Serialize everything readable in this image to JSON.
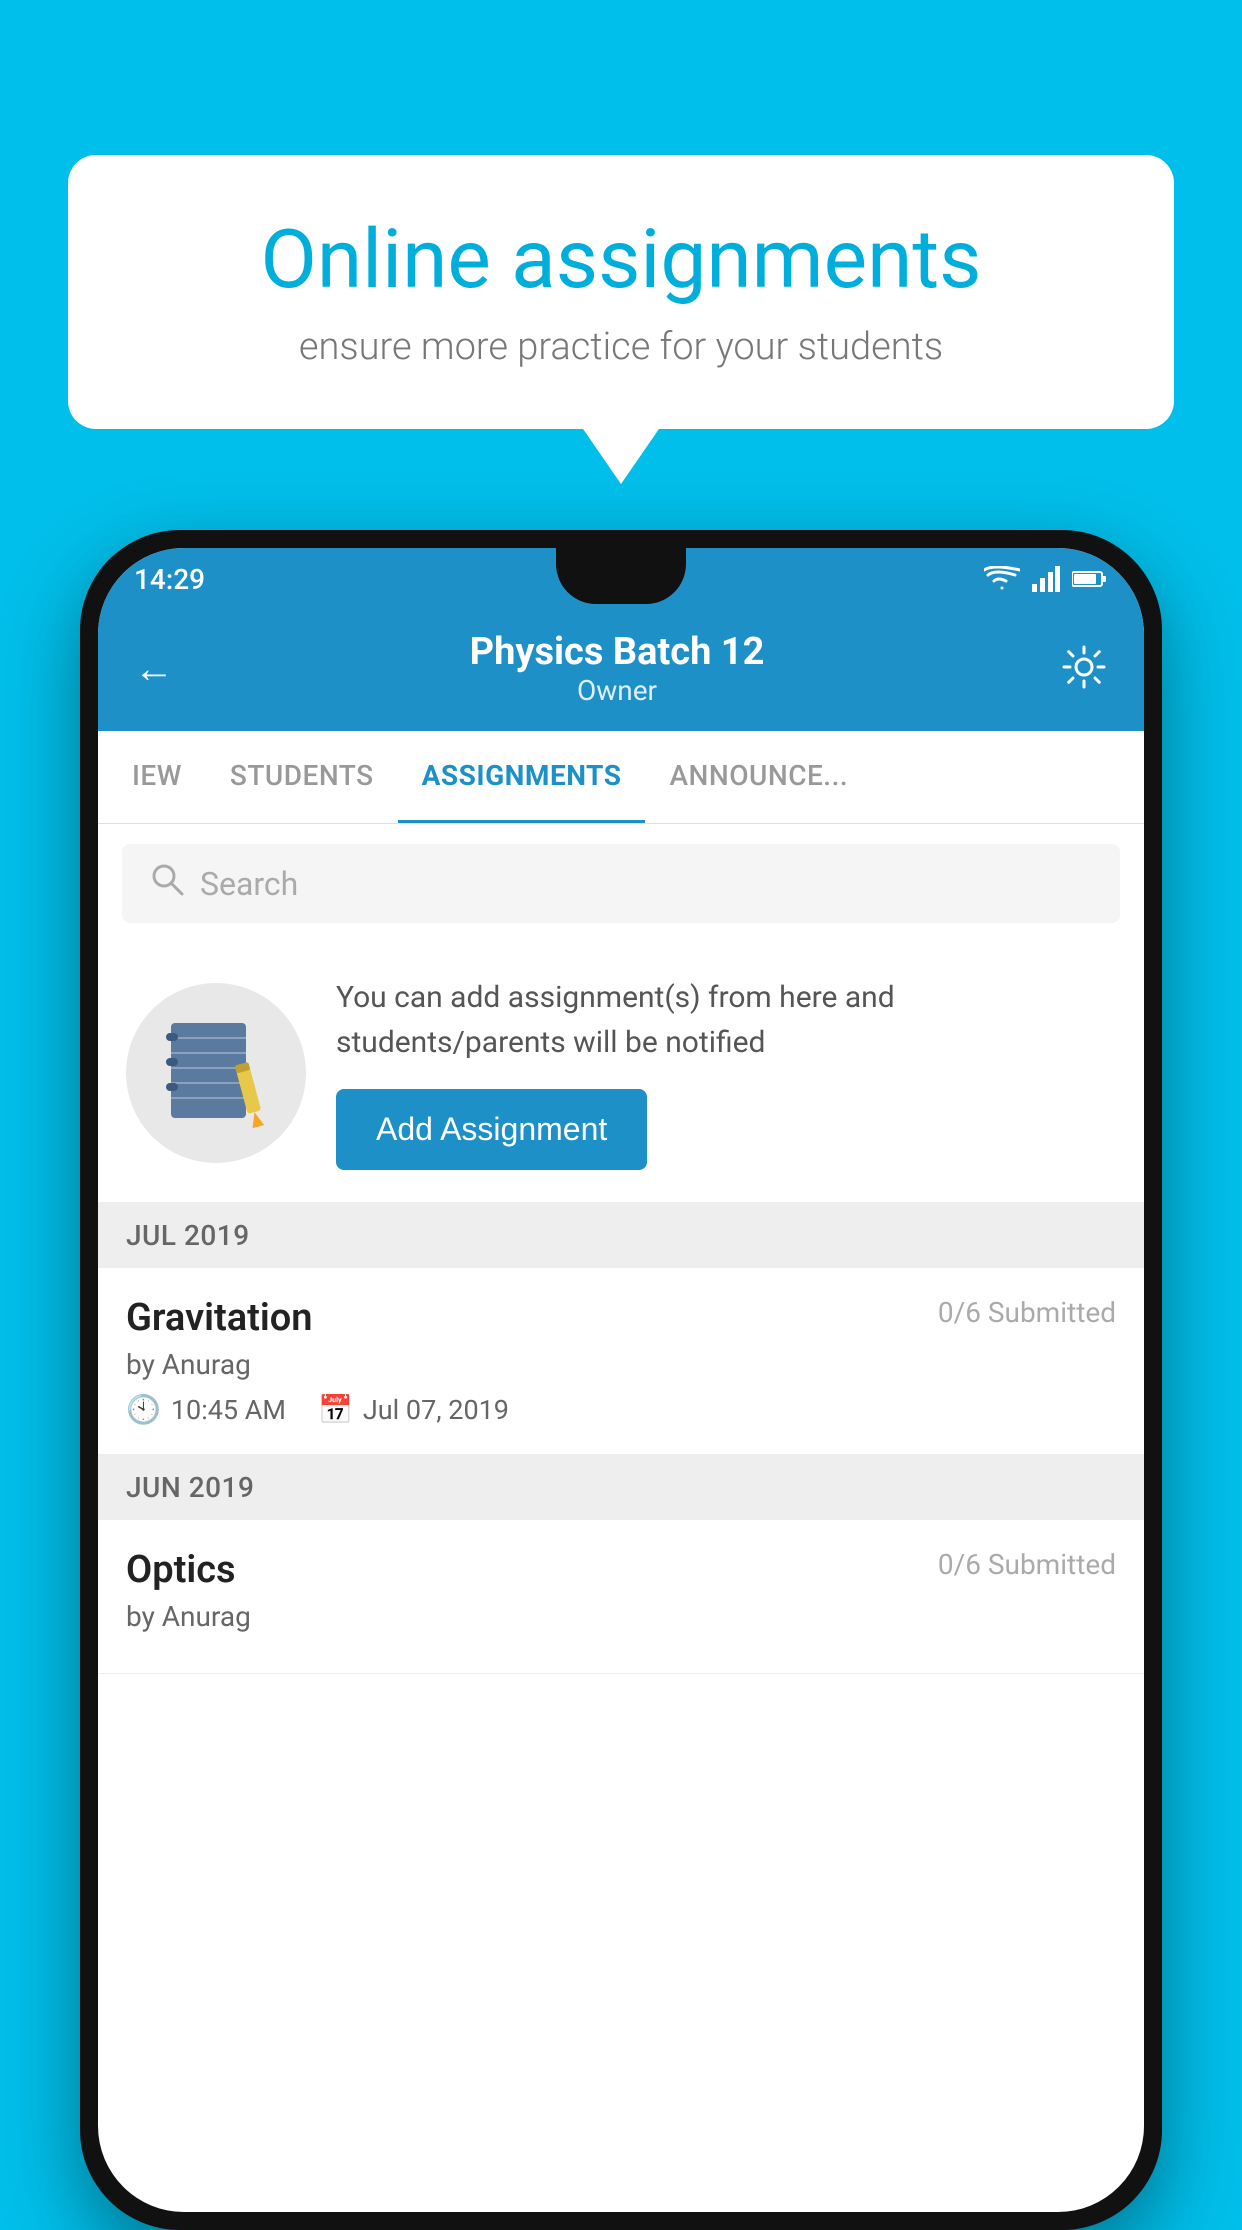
{
  "background": {
    "color": "#00BFEA"
  },
  "speech_bubble": {
    "title": "Online assignments",
    "subtitle": "ensure more practice for your students"
  },
  "phone": {
    "status_bar": {
      "time": "14:29"
    },
    "header": {
      "title": "Physics Batch 12",
      "subtitle": "Owner",
      "back_label": "←",
      "gear_label": "⚙"
    },
    "tabs": [
      {
        "label": "IEW",
        "active": false
      },
      {
        "label": "STUDENTS",
        "active": false
      },
      {
        "label": "ASSIGNMENTS",
        "active": true
      },
      {
        "label": "ANNOUNCEMENTS",
        "active": false
      }
    ],
    "search": {
      "placeholder": "Search"
    },
    "promo": {
      "text": "You can add assignment(s) from here and students/parents will be notified",
      "button_label": "Add Assignment"
    },
    "sections": [
      {
        "label": "JUL 2019",
        "assignments": [
          {
            "name": "Gravitation",
            "submitted": "0/6 Submitted",
            "by": "by Anurag",
            "time": "10:45 AM",
            "date": "Jul 07, 2019"
          }
        ]
      },
      {
        "label": "JUN 2019",
        "assignments": [
          {
            "name": "Optics",
            "submitted": "0/6 Submitted",
            "by": "by Anurag",
            "time": "",
            "date": ""
          }
        ]
      }
    ]
  }
}
